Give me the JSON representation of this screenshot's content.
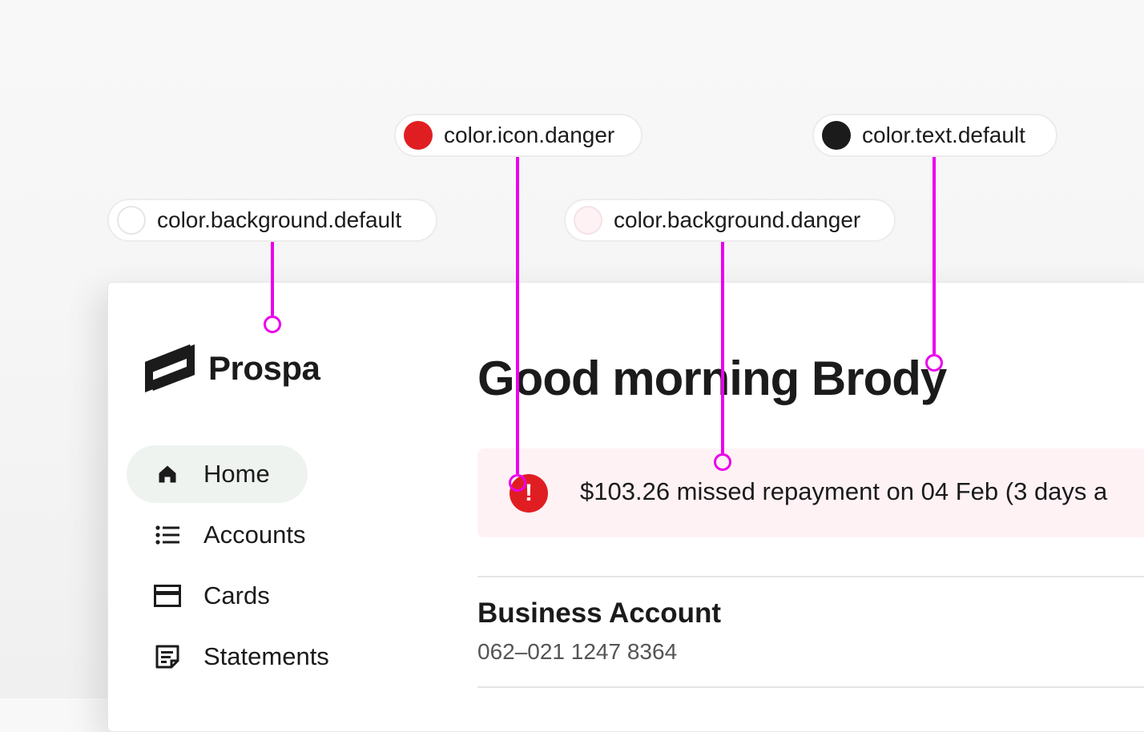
{
  "app": {
    "brand": "Prospa",
    "greeting": "Good morning Brody"
  },
  "nav": {
    "items": [
      {
        "label": "Home",
        "icon": "home-icon",
        "active": true
      },
      {
        "label": "Accounts",
        "icon": "list-icon",
        "active": false
      },
      {
        "label": "Cards",
        "icon": "card-icon",
        "active": false
      },
      {
        "label": "Statements",
        "icon": "statement-icon",
        "active": false
      }
    ]
  },
  "alert": {
    "icon": "exclamation-icon",
    "glyph": "!",
    "text": "$103.26 missed repayment on 04 Feb (3 days a"
  },
  "account": {
    "name": "Business Account",
    "number": "062–021 1247 8364"
  },
  "annotations": [
    {
      "label": "color.background.default",
      "swatch": "#ffffff"
    },
    {
      "label": "color.icon.danger",
      "swatch": "#e01e22"
    },
    {
      "label": "color.background.danger",
      "swatch": "#fff2f5"
    },
    {
      "label": "color.text.default",
      "swatch": "#1b1b1b"
    }
  ],
  "colors": {
    "annotation_line": "#ec00ec",
    "danger": "#e01e22",
    "danger_bg": "#fff2f5",
    "text": "#1b1b1b",
    "nav_active_bg": "#eff3f0"
  }
}
